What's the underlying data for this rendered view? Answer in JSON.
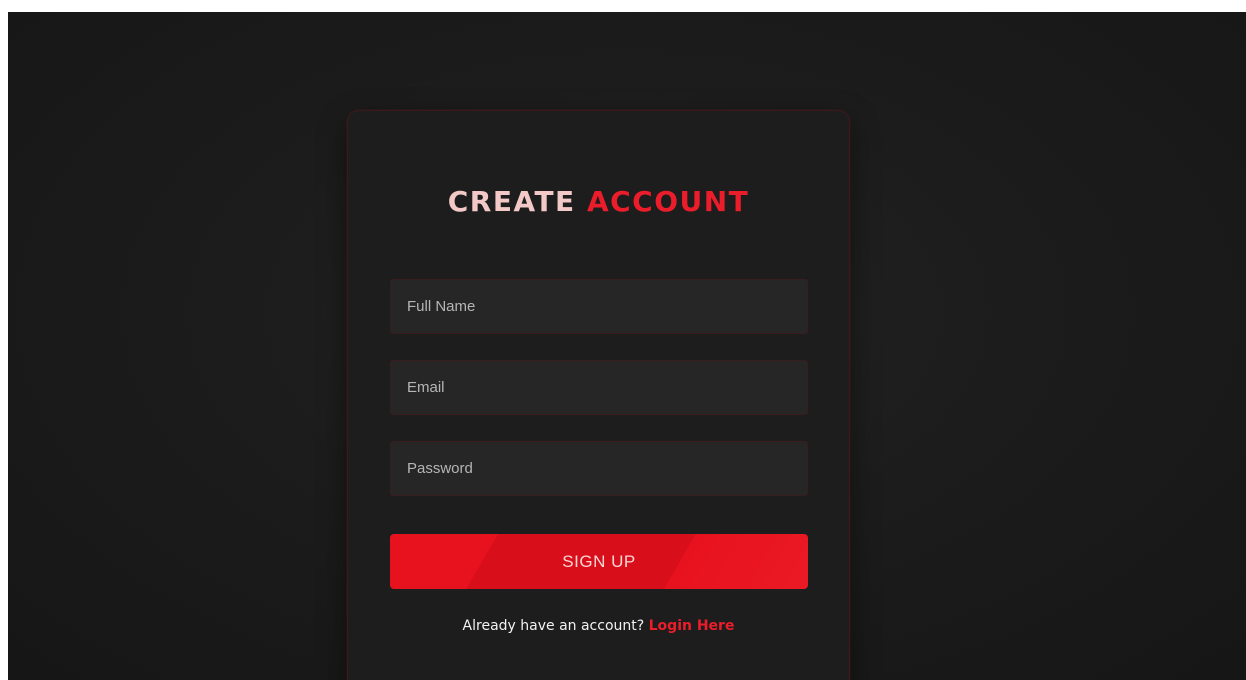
{
  "form": {
    "title_part1": "CREATE",
    "title_part2": "ACCOUNT",
    "fields": [
      {
        "placeholder": "Full Name",
        "value": ""
      },
      {
        "placeholder": "Email",
        "value": ""
      },
      {
        "placeholder": "Password",
        "value": ""
      }
    ],
    "submit_label": "SIGN UP",
    "footer_text": "Already have an account?",
    "login_link": "Login Here"
  },
  "colors": {
    "accent": "#ec1d2a",
    "background": "#1c1c1c",
    "card": "#1d1d1d",
    "input": "#262626"
  }
}
